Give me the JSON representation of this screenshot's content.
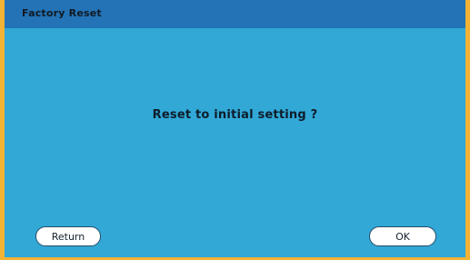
{
  "dialog": {
    "title": "Factory Reset",
    "message": "Reset to initial setting ?",
    "buttons": {
      "return_label": "Return",
      "ok_label": "OK"
    }
  },
  "colors": {
    "frame": "#f2b233",
    "dialog_bg": "#31a8d6",
    "titlebar_bg": "#2373b6",
    "button_bg": "#ffffff"
  }
}
